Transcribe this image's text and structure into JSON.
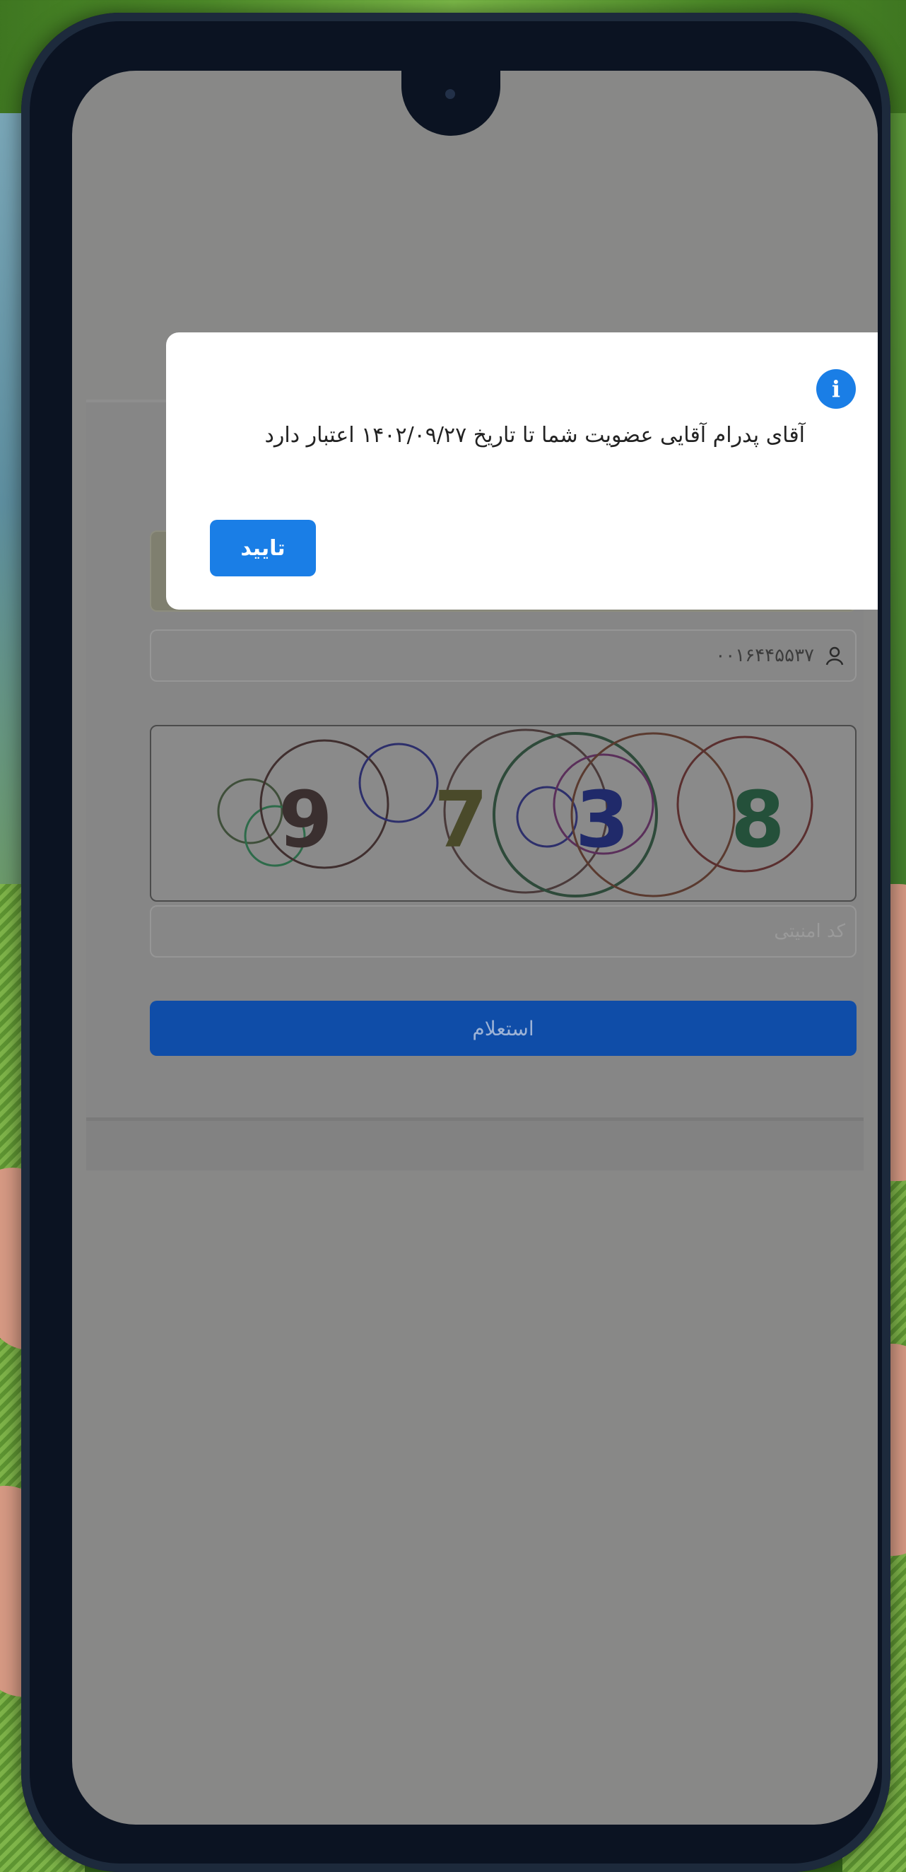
{
  "dialog": {
    "message": "آقای پدرام آقایی عضویت شما تا تاریخ ۱۴۰۲/۰۹/۲۷ اعتبار دارد",
    "confirm_label": "تایید",
    "icon": "info-icon"
  },
  "form": {
    "national_code_value": "۰۰۱۶۴۴۵۵۳۷",
    "captcha_digits": "9 7 3 8",
    "captcha_placeholder": "کد امنیتی",
    "submit_label": "استعلام"
  },
  "colors": {
    "accent": "#1a7ee6",
    "primary_button": "#0f4da8",
    "overlay": "#888887"
  }
}
